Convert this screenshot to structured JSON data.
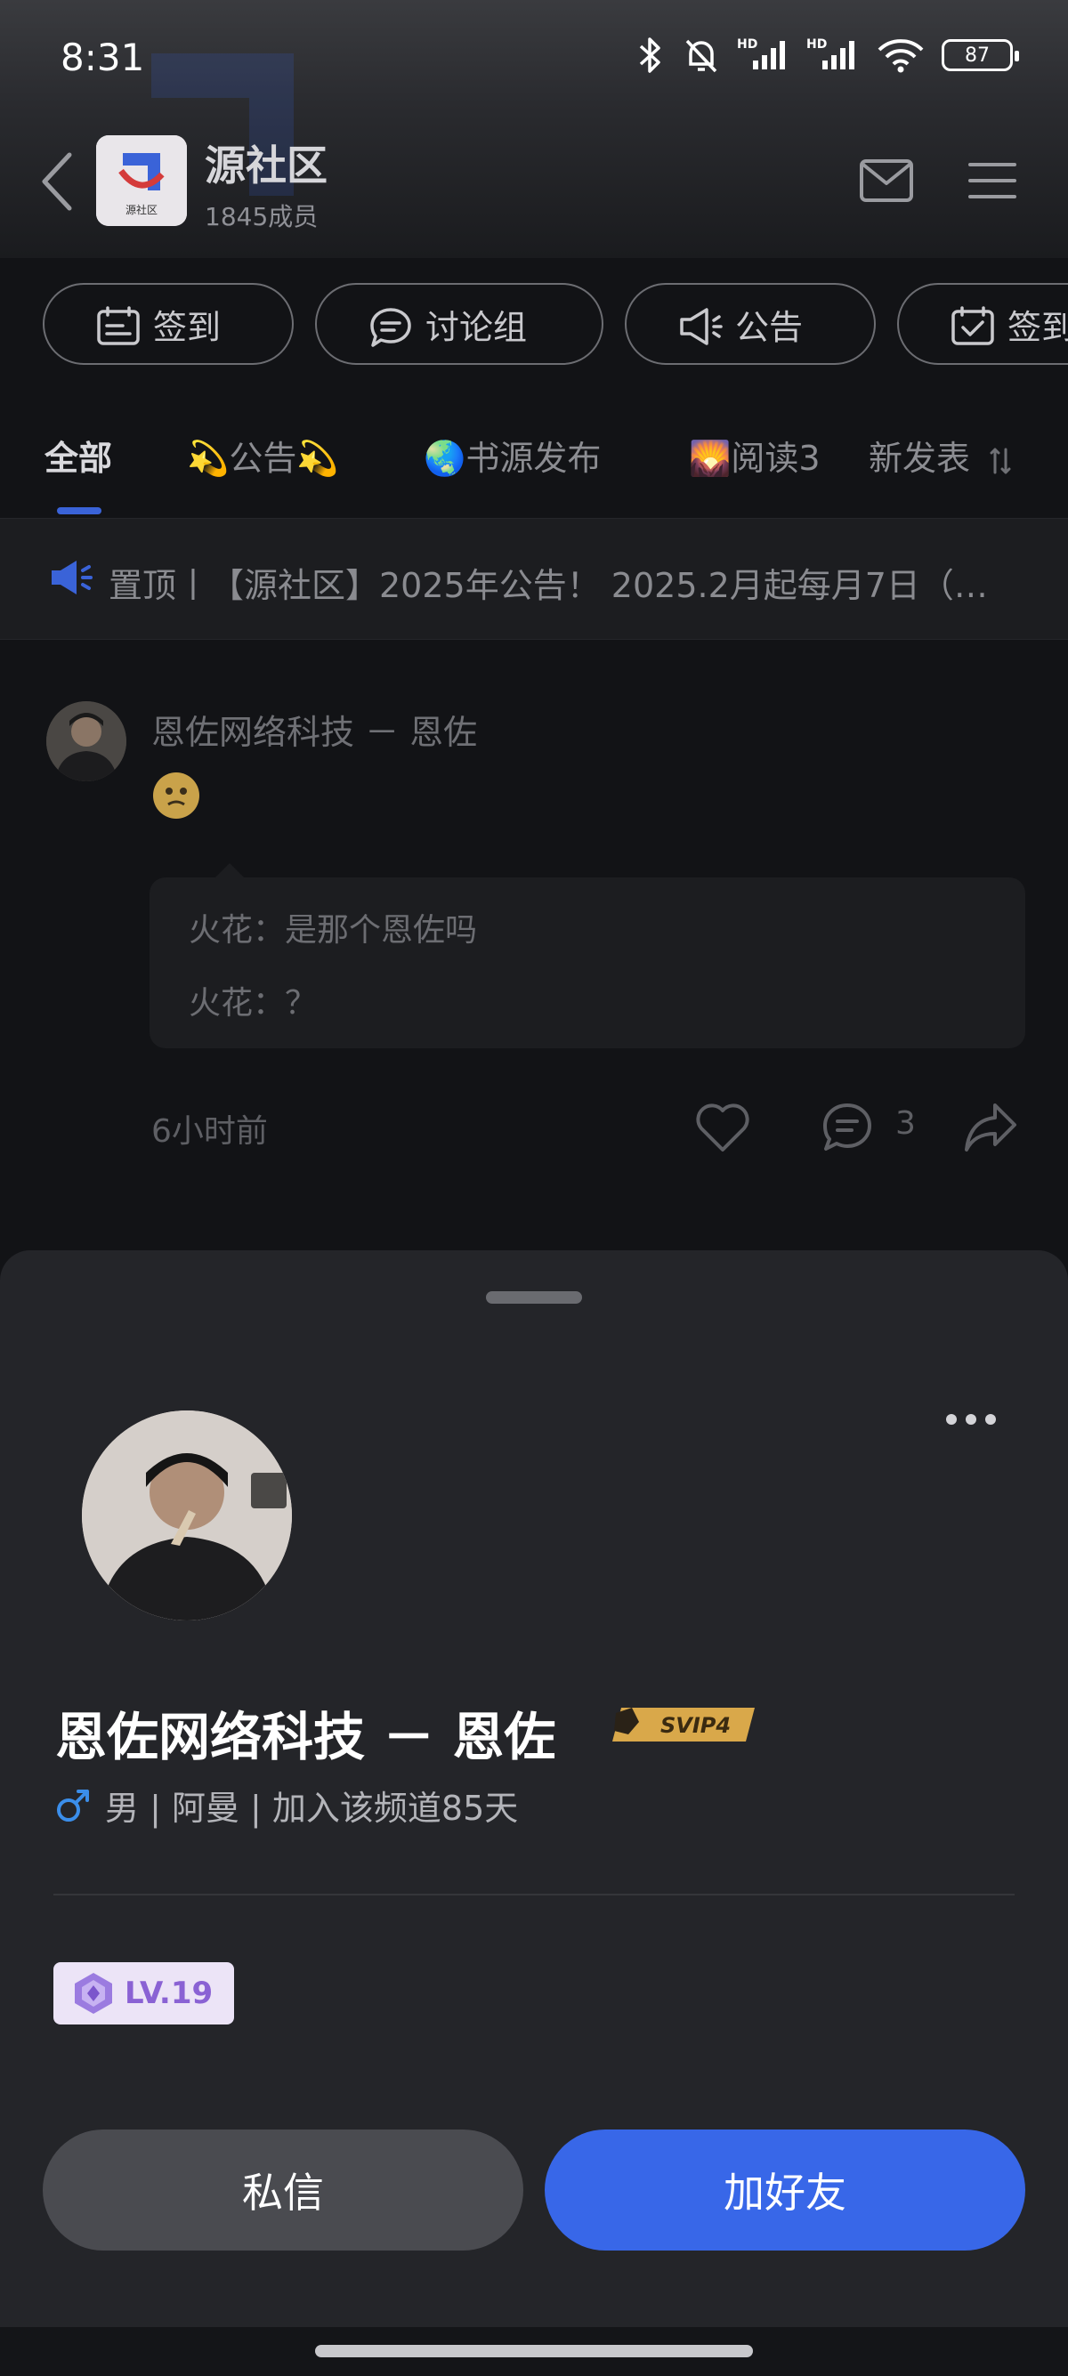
{
  "status_bar": {
    "time": "8:31",
    "battery": "87",
    "icons": [
      "bluetooth-icon",
      "mute-bell-icon",
      "hd-signal-icon",
      "hd-signal-icon",
      "wifi-icon",
      "battery-icon"
    ]
  },
  "header": {
    "channel_name": "源社区",
    "member_count": "1845成员",
    "logo_caption": "源社区"
  },
  "chips": [
    {
      "label": "签到",
      "icon": "checkin-icon"
    },
    {
      "label": "讨论组",
      "icon": "chat-bubble-icon"
    },
    {
      "label": "公告",
      "icon": "megaphone-icon"
    },
    {
      "label": "签到",
      "icon": "calendar-check-icon"
    }
  ],
  "tabs": [
    {
      "label": "全部",
      "active": true
    },
    {
      "label": "💫公告💫",
      "active": false
    },
    {
      "label": "🌏书源发布",
      "active": false
    },
    {
      "label": "🌄阅读3",
      "active": false
    }
  ],
  "sort_label": "新发表",
  "pinned": {
    "text": "置顶丨【源社区】2025年公告！ 2025.2月起每月7日（…"
  },
  "post": {
    "author": "恩佐网络科技 － 恩佐",
    "replies": [
      {
        "text": "火花：是那个恩佐吗"
      },
      {
        "text": "火花：？"
      }
    ],
    "time": "6小时前",
    "comment_count": "3"
  },
  "profile": {
    "name": "恩佐网络科技 － 恩佐",
    "badge": "SVIP4",
    "meta": "男 | 阿曼 | 加入该频道85天",
    "level": "LV.19",
    "dm_label": "私信",
    "add_friend_label": "加好友"
  },
  "colors": {
    "accent": "#3867e8",
    "level_text": "#8a62d4",
    "gender_icon": "#3b8eea",
    "svip_gold": "#d9a84a"
  }
}
